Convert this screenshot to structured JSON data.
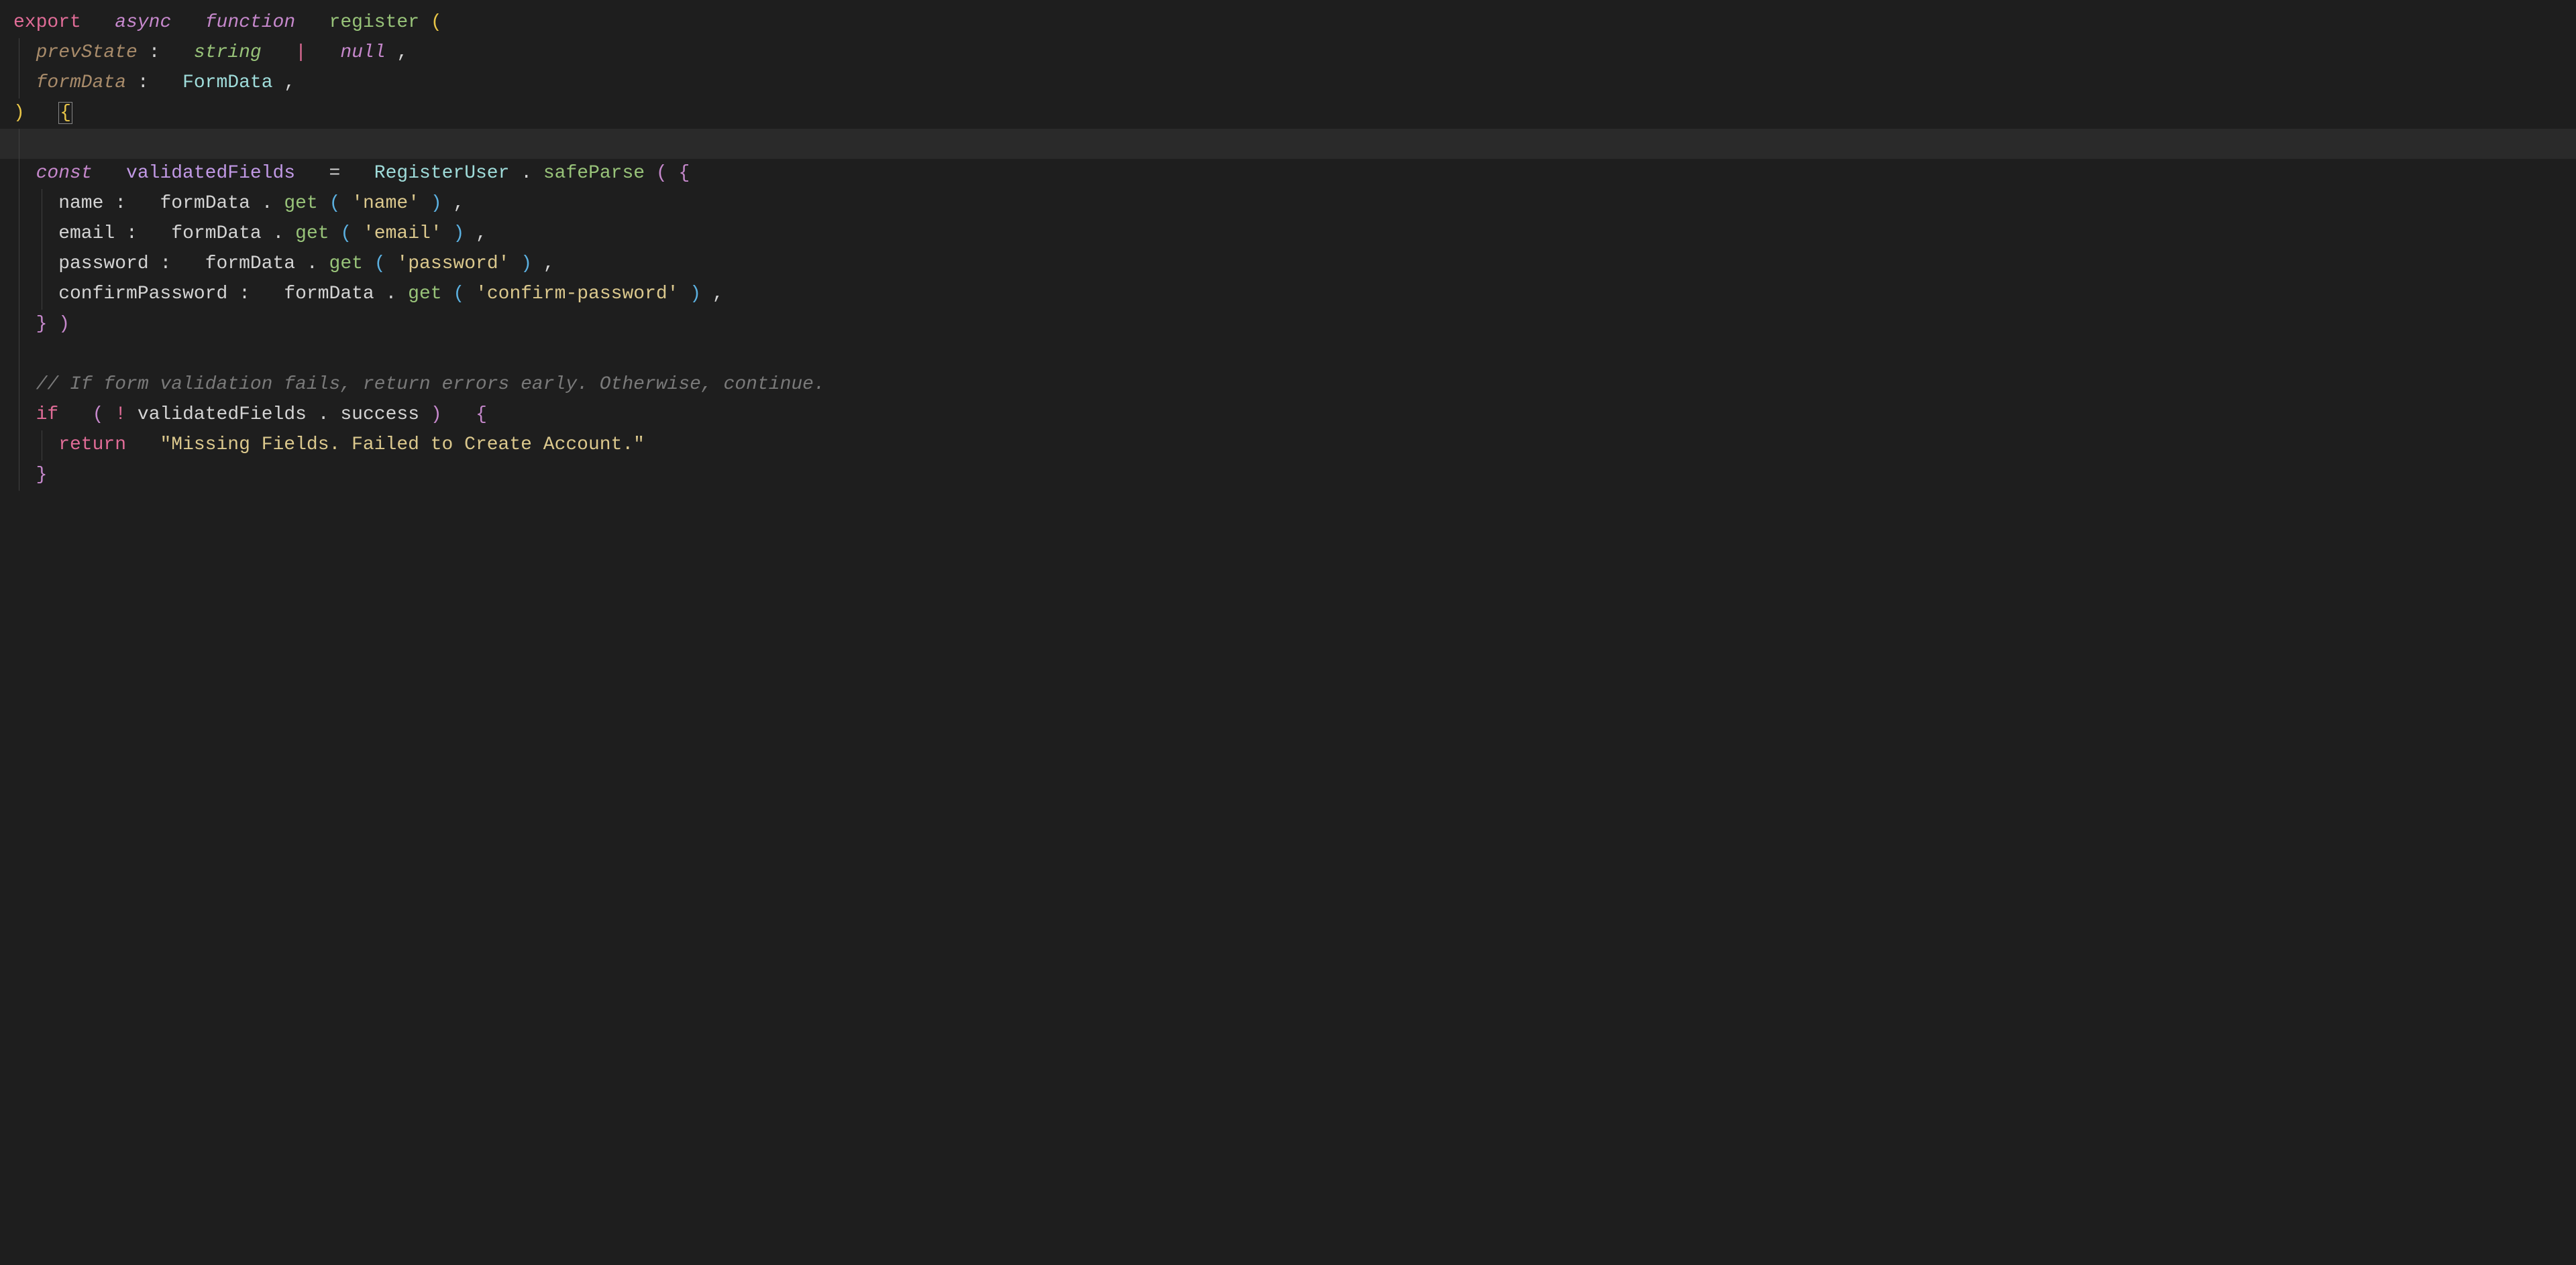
{
  "line1": {
    "export": "export",
    "async": "async",
    "function": "function",
    "name": "register",
    "lparen": "("
  },
  "line2": {
    "param": "prevState",
    "colon": ":",
    "type1": "string",
    "pipe": "|",
    "type2": "null",
    "comma": ","
  },
  "line3": {
    "param": "formData",
    "colon": ":",
    "type": "FormData",
    "comma": ","
  },
  "line4": {
    "rparen": ")",
    "lbrace": "{"
  },
  "line6": {
    "const": "const",
    "var": "validatedFields",
    "eq": "=",
    "class": "RegisterUser",
    "dot": ".",
    "method": "safeParse",
    "lparen": "(",
    "lbrace": "{"
  },
  "line7": {
    "prop": "name",
    "colon": ":",
    "obj": "formData",
    "dot": ".",
    "method": "get",
    "lparen": "(",
    "str": "'name'",
    "rparen": ")",
    "comma": ","
  },
  "line8": {
    "prop": "email",
    "colon": ":",
    "obj": "formData",
    "dot": ".",
    "method": "get",
    "lparen": "(",
    "str": "'email'",
    "rparen": ")",
    "comma": ","
  },
  "line9": {
    "prop": "password",
    "colon": ":",
    "obj": "formData",
    "dot": ".",
    "method": "get",
    "lparen": "(",
    "str": "'password'",
    "rparen": ")",
    "comma": ","
  },
  "line10": {
    "prop": "confirmPassword",
    "colon": ":",
    "obj": "formData",
    "dot": ".",
    "method": "get",
    "lparen": "(",
    "str": "'confirm-password'",
    "rparen": ")",
    "comma": ","
  },
  "line11": {
    "rbrace": "}",
    "rparen": ")"
  },
  "line13": {
    "comment": "// If form validation fails, return errors early. Otherwise, continue."
  },
  "line14": {
    "if": "if",
    "lparen": "(",
    "bang": "!",
    "var": "validatedFields",
    "dot": ".",
    "prop": "success",
    "rparen": ")",
    "lbrace": "{"
  },
  "line15": {
    "return": "return",
    "str": "\"Missing Fields. Failed to Create Account.\""
  },
  "line16": {
    "rbrace": "}"
  }
}
